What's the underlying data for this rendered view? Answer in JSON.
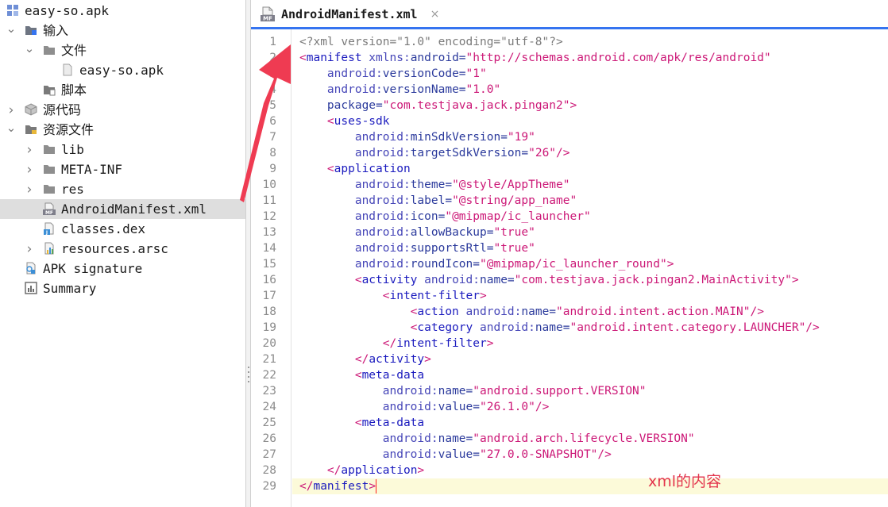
{
  "tree": {
    "items": [
      {
        "label": "easy-so.apk",
        "icon": "apk-module-icon",
        "depth": 0,
        "chevron": "",
        "selected": false,
        "cjk": false
      },
      {
        "label": "输入",
        "icon": "folder-input-icon",
        "depth": 0,
        "chevron": "down",
        "selected": false,
        "cjk": true
      },
      {
        "label": "文件",
        "icon": "folder-icon",
        "depth": 1,
        "chevron": "down",
        "selected": false,
        "cjk": true
      },
      {
        "label": "easy-so.apk",
        "icon": "file-icon",
        "depth": 2,
        "chevron": "",
        "selected": false,
        "cjk": false
      },
      {
        "label": "脚本",
        "icon": "script-folder-icon",
        "depth": 1,
        "chevron": "",
        "selected": false,
        "cjk": true
      },
      {
        "label": "源代码",
        "icon": "source-package-icon",
        "depth": 0,
        "chevron": "right",
        "selected": false,
        "cjk": true
      },
      {
        "label": "资源文件",
        "icon": "resources-folder-icon",
        "depth": 0,
        "chevron": "down",
        "selected": false,
        "cjk": true
      },
      {
        "label": "lib",
        "icon": "folder-icon",
        "depth": 1,
        "chevron": "right",
        "selected": false,
        "cjk": false
      },
      {
        "label": "META-INF",
        "icon": "folder-icon",
        "depth": 1,
        "chevron": "right",
        "selected": false,
        "cjk": false
      },
      {
        "label": "res",
        "icon": "folder-icon",
        "depth": 1,
        "chevron": "right",
        "selected": false,
        "cjk": false
      },
      {
        "label": "AndroidManifest.xml",
        "icon": "manifest-file-icon",
        "depth": 1,
        "chevron": "",
        "selected": true,
        "cjk": false
      },
      {
        "label": "classes.dex",
        "icon": "dex-file-icon",
        "depth": 1,
        "chevron": "",
        "selected": false,
        "cjk": false
      },
      {
        "label": "resources.arsc",
        "icon": "arsc-file-icon",
        "depth": 1,
        "chevron": "right",
        "selected": false,
        "cjk": false
      },
      {
        "label": "APK signature",
        "icon": "signature-icon",
        "depth": 0,
        "chevron": "",
        "selected": false,
        "cjk": false
      },
      {
        "label": "Summary",
        "icon": "summary-icon",
        "depth": 0,
        "chevron": "",
        "selected": false,
        "cjk": false
      }
    ]
  },
  "editor": {
    "tab_title": "AndroidManifest.xml",
    "tab_close": "×",
    "tab_badge": "MF",
    "current_line": 29,
    "lines": [
      [
        [
          "t-prolog",
          "<?xml version=\"1.0\" encoding=\"utf-8\"?>"
        ]
      ],
      [
        [
          "t-punc",
          "<"
        ],
        [
          "t-tag",
          "manifest"
        ],
        [
          "t-ns",
          " xmlns:"
        ],
        [
          "t-attr",
          "android"
        ],
        [
          "t-eq",
          "="
        ],
        [
          "t-str",
          "\"http://schemas.android.com/apk/res/android\""
        ]
      ],
      [
        [
          "t-ns",
          "    android:"
        ],
        [
          "t-attr",
          "versionCode"
        ],
        [
          "t-eq",
          "="
        ],
        [
          "t-str",
          "\"1\""
        ]
      ],
      [
        [
          "t-ns",
          "    android:"
        ],
        [
          "t-attr",
          "versionName"
        ],
        [
          "t-eq",
          "="
        ],
        [
          "t-str",
          "\"1.0\""
        ]
      ],
      [
        [
          "t-attr",
          "    package"
        ],
        [
          "t-eq",
          "="
        ],
        [
          "t-str",
          "\"com.testjava.jack.pingan2\""
        ],
        [
          "t-punc",
          ">"
        ]
      ],
      [
        [
          "t-punc",
          "    <"
        ],
        [
          "t-tag",
          "uses-sdk"
        ]
      ],
      [
        [
          "t-ns",
          "        android:"
        ],
        [
          "t-attr",
          "minSdkVersion"
        ],
        [
          "t-eq",
          "="
        ],
        [
          "t-str",
          "\"19\""
        ]
      ],
      [
        [
          "t-ns",
          "        android:"
        ],
        [
          "t-attr",
          "targetSdkVersion"
        ],
        [
          "t-eq",
          "="
        ],
        [
          "t-str",
          "\"26\""
        ],
        [
          "t-punc",
          "/>"
        ]
      ],
      [
        [
          "t-punc",
          "    <"
        ],
        [
          "t-tag",
          "application"
        ]
      ],
      [
        [
          "t-ns",
          "        android:"
        ],
        [
          "t-attr",
          "theme"
        ],
        [
          "t-eq",
          "="
        ],
        [
          "t-str",
          "\"@style/AppTheme\""
        ]
      ],
      [
        [
          "t-ns",
          "        android:"
        ],
        [
          "t-attr",
          "label"
        ],
        [
          "t-eq",
          "="
        ],
        [
          "t-str",
          "\"@string/app_name\""
        ]
      ],
      [
        [
          "t-ns",
          "        android:"
        ],
        [
          "t-attr",
          "icon"
        ],
        [
          "t-eq",
          "="
        ],
        [
          "t-str",
          "\"@mipmap/ic_launcher\""
        ]
      ],
      [
        [
          "t-ns",
          "        android:"
        ],
        [
          "t-attr",
          "allowBackup"
        ],
        [
          "t-eq",
          "="
        ],
        [
          "t-str",
          "\"true\""
        ]
      ],
      [
        [
          "t-ns",
          "        android:"
        ],
        [
          "t-attr",
          "supportsRtl"
        ],
        [
          "t-eq",
          "="
        ],
        [
          "t-str",
          "\"true\""
        ]
      ],
      [
        [
          "t-ns",
          "        android:"
        ],
        [
          "t-attr",
          "roundIcon"
        ],
        [
          "t-eq",
          "="
        ],
        [
          "t-str",
          "\"@mipmap/ic_launcher_round\""
        ],
        [
          "t-punc",
          ">"
        ]
      ],
      [
        [
          "t-punc",
          "        <"
        ],
        [
          "t-tag",
          "activity"
        ],
        [
          "t-ns",
          " android:"
        ],
        [
          "t-attr",
          "name"
        ],
        [
          "t-eq",
          "="
        ],
        [
          "t-str",
          "\"com.testjava.jack.pingan2.MainActivity\""
        ],
        [
          "t-punc",
          ">"
        ]
      ],
      [
        [
          "t-punc",
          "            <"
        ],
        [
          "t-tag",
          "intent-filter"
        ],
        [
          "t-punc",
          ">"
        ]
      ],
      [
        [
          "t-punc",
          "                <"
        ],
        [
          "t-tag",
          "action"
        ],
        [
          "t-ns",
          " android:"
        ],
        [
          "t-attr",
          "name"
        ],
        [
          "t-eq",
          "="
        ],
        [
          "t-str",
          "\"android.intent.action.MAIN\""
        ],
        [
          "t-punc",
          "/>"
        ]
      ],
      [
        [
          "t-punc",
          "                <"
        ],
        [
          "t-tag",
          "category"
        ],
        [
          "t-ns",
          " android:"
        ],
        [
          "t-attr",
          "name"
        ],
        [
          "t-eq",
          "="
        ],
        [
          "t-str",
          "\"android.intent.category.LAUNCHER\""
        ],
        [
          "t-punc",
          "/>"
        ]
      ],
      [
        [
          "t-punc",
          "            </"
        ],
        [
          "t-tag",
          "intent-filter"
        ],
        [
          "t-punc",
          ">"
        ]
      ],
      [
        [
          "t-punc",
          "        </"
        ],
        [
          "t-tag",
          "activity"
        ],
        [
          "t-punc",
          ">"
        ]
      ],
      [
        [
          "t-punc",
          "        <"
        ],
        [
          "t-tag",
          "meta-data"
        ]
      ],
      [
        [
          "t-ns",
          "            android:"
        ],
        [
          "t-attr",
          "name"
        ],
        [
          "t-eq",
          "="
        ],
        [
          "t-str",
          "\"android.support.VERSION\""
        ]
      ],
      [
        [
          "t-ns",
          "            android:"
        ],
        [
          "t-attr",
          "value"
        ],
        [
          "t-eq",
          "="
        ],
        [
          "t-str",
          "\"26.1.0\""
        ],
        [
          "t-punc",
          "/>"
        ]
      ],
      [
        [
          "t-punc",
          "        <"
        ],
        [
          "t-tag",
          "meta-data"
        ]
      ],
      [
        [
          "t-ns",
          "            android:"
        ],
        [
          "t-attr",
          "name"
        ],
        [
          "t-eq",
          "="
        ],
        [
          "t-str",
          "\"android.arch.lifecycle.VERSION\""
        ]
      ],
      [
        [
          "t-ns",
          "            android:"
        ],
        [
          "t-attr",
          "value"
        ],
        [
          "t-eq",
          "="
        ],
        [
          "t-str",
          "\"27.0.0-SNAPSHOT\""
        ],
        [
          "t-punc",
          "/>"
        ]
      ],
      [
        [
          "t-punc",
          "    </"
        ],
        [
          "t-tag",
          "application"
        ],
        [
          "t-punc",
          ">"
        ]
      ],
      [
        [
          "t-punc",
          "</"
        ],
        [
          "t-tag",
          "manifest"
        ],
        [
          "t-punc",
          ">"
        ]
      ]
    ]
  },
  "annotation": {
    "text": "xml的内容",
    "color": "#e3344c"
  },
  "colors": {
    "accent": "#3574f0",
    "selection": "#dedede",
    "current_line": "#fcfad9"
  }
}
